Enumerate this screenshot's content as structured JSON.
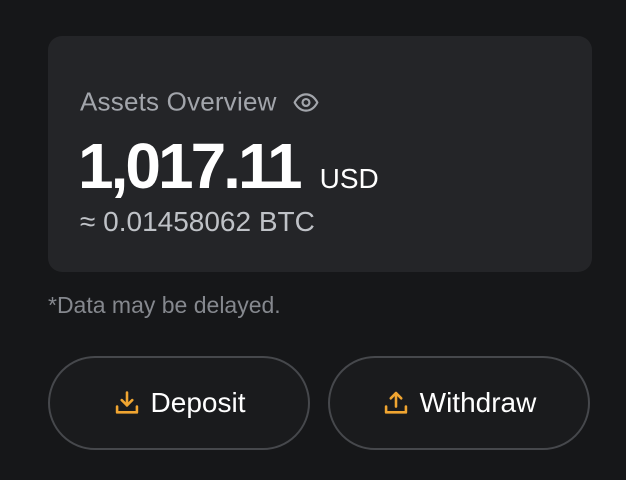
{
  "assets": {
    "title": "Assets Overview",
    "balance": "1,017.11",
    "currency": "USD",
    "btc_equivalent": "≈ 0.01458062 BTC"
  },
  "disclaimer": "*Data may be delayed.",
  "actions": {
    "deposit_label": "Deposit",
    "withdraw_label": "Withdraw"
  },
  "icons": {
    "visibility": "eye-icon",
    "deposit": "download-icon",
    "withdraw": "upload-icon"
  },
  "colors": {
    "background": "#161719",
    "card": "#242528",
    "accent": "#f0a531"
  }
}
